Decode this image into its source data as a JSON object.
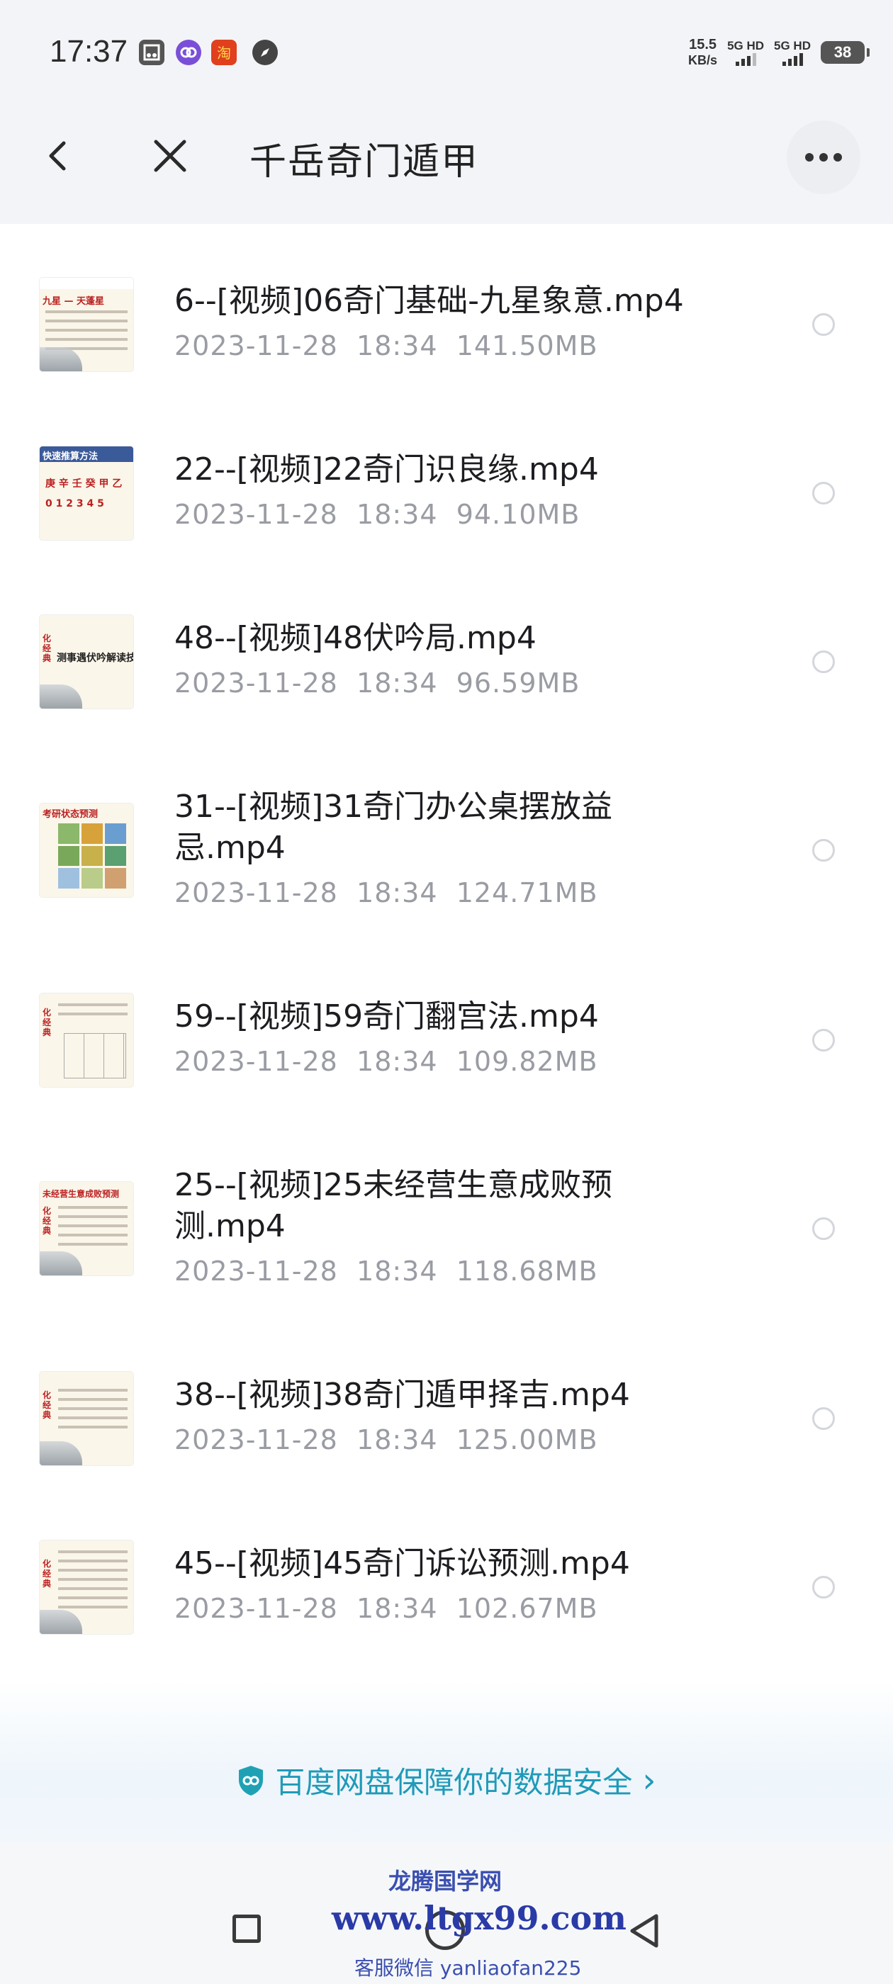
{
  "status_bar": {
    "time": "17:37",
    "net_speed_value": "15.5",
    "net_speed_unit": "KB/s",
    "sim1": "5G HD",
    "sim2": "5G HD",
    "battery": "38",
    "app_icons": [
      "screenshot-icon",
      "link-app-icon",
      "taobao-icon",
      "compass-icon"
    ]
  },
  "header": {
    "title": "千岳奇门遁甲",
    "back_icon": "chevron-left-icon",
    "close_icon": "close-icon",
    "more_icon": "more-icon"
  },
  "files": [
    {
      "name": "6--[视频]06奇门基础-九星象意.mp4",
      "date": "2023-11-28",
      "time": "18:34",
      "size": "141.50MB",
      "thumb_label": "九星 — 天蓬星"
    },
    {
      "name": "22--[视频]22奇门识良缘.mp4",
      "date": "2023-11-28",
      "time": "18:34",
      "size": "94.10MB",
      "thumb_label": "快速推算方法"
    },
    {
      "name": "48--[视频]48伏吟局.mp4",
      "date": "2023-11-28",
      "time": "18:34",
      "size": "96.59MB",
      "thumb_label": "测事遇伏吟解读技巧"
    },
    {
      "name": "31--[视频]31奇门办公桌摆放益忌.mp4",
      "date": "2023-11-28",
      "time": "18:34",
      "size": "124.71MB",
      "thumb_label": "考研状态预测"
    },
    {
      "name": "59--[视频]59奇门翻宫法.mp4",
      "date": "2023-11-28",
      "time": "18:34",
      "size": "109.82MB",
      "thumb_label": ""
    },
    {
      "name": "25--[视频]25未经营生意成败预测.mp4",
      "date": "2023-11-28",
      "time": "18:34",
      "size": "118.68MB",
      "thumb_label": "未经营生意成败预测"
    },
    {
      "name": "38--[视频]38奇门遁甲择吉.mp4",
      "date": "2023-11-28",
      "time": "18:34",
      "size": "125.00MB",
      "thumb_label": ""
    },
    {
      "name": "45--[视频]45奇门诉讼预测.mp4",
      "date": "2023-11-28",
      "time": "18:34",
      "size": "102.67MB",
      "thumb_label": ""
    }
  ],
  "security_banner": {
    "text": "百度网盘保障你的数据安全",
    "chevron": "›",
    "icon": "shield-icon",
    "color": "#1f9ab8"
  },
  "watermark": {
    "line1": "龙腾国学网",
    "line2": "www.ltgx99.com",
    "line3": "客服微信 yanliaofan225"
  }
}
